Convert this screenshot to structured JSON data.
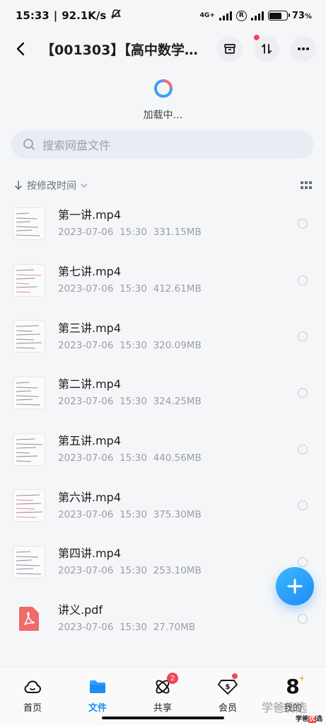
{
  "status_bar": {
    "time": "15:33",
    "speed": "92.1K/s",
    "network": "4G+",
    "battery": "73",
    "battery_unit": "%",
    "battery_level": 0.73
  },
  "header": {
    "title": "【001303】【高中数学…"
  },
  "loading": {
    "text": "加载中…"
  },
  "search": {
    "placeholder": "搜索网盘文件"
  },
  "sort": {
    "label": "按修改时间"
  },
  "files": [
    {
      "name": "第一讲.mp4",
      "date": "2023-07-06",
      "time": "15:30",
      "size": "331.15MB",
      "type": "video"
    },
    {
      "name": "第七讲.mp4",
      "date": "2023-07-06",
      "time": "15:30",
      "size": "412.61MB",
      "type": "video"
    },
    {
      "name": "第三讲.mp4",
      "date": "2023-07-06",
      "time": "15:30",
      "size": "320.09MB",
      "type": "video"
    },
    {
      "name": "第二讲.mp4",
      "date": "2023-07-06",
      "time": "15:30",
      "size": "324.25MB",
      "type": "video"
    },
    {
      "name": "第五讲.mp4",
      "date": "2023-07-06",
      "time": "15:30",
      "size": "440.56MB",
      "type": "video"
    },
    {
      "name": "第六讲.mp4",
      "date": "2023-07-06",
      "time": "15:30",
      "size": "375.30MB",
      "type": "video"
    },
    {
      "name": "第四讲.mp4",
      "date": "2023-07-06",
      "time": "15:30",
      "size": "253.10MB",
      "type": "video"
    },
    {
      "name": "讲义.pdf",
      "date": "2023-07-06",
      "time": "15:30",
      "size": "27.70MB",
      "type": "pdf"
    }
  ],
  "nav": {
    "home": "首页",
    "files": "文件",
    "share": "共享",
    "share_badge": "2",
    "vip": "会员",
    "mine": "我的",
    "mine_number": "8"
  },
  "watermark": {
    "text": "学爸优选",
    "logo_a": "学爸",
    "logo_b": "优",
    "logo_c": "选"
  },
  "colors": {
    "accent": "#1e8cf5",
    "badge": "#f0465a",
    "pdf": "#ef6a6a"
  }
}
